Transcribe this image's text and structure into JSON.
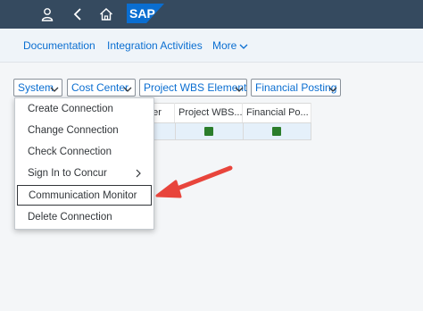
{
  "shell": {
    "buttons": [
      {
        "name": "user-icon"
      },
      {
        "name": "back-icon"
      },
      {
        "name": "home-icon"
      }
    ],
    "logo_text": "SAP",
    "logo_color": "#0a6ed1"
  },
  "menubar": {
    "items": [
      {
        "label": "Documentation"
      },
      {
        "label": "Integration Activities"
      },
      {
        "label": "More"
      }
    ]
  },
  "filters": [
    {
      "label": "System"
    },
    {
      "label": "Cost Center"
    },
    {
      "label": "Project WBS Element"
    },
    {
      "label": "Financial Posting"
    }
  ],
  "table": {
    "headers": [
      "nter",
      "Project WBS...",
      "Financial Po..."
    ],
    "status_color": "#2b7d2b"
  },
  "dropdown": {
    "items": [
      {
        "label": "Create Connection",
        "submenu": false
      },
      {
        "label": "Change Connection",
        "submenu": false
      },
      {
        "label": "Check Connection",
        "submenu": false
      },
      {
        "label": "Sign In to Concur",
        "submenu": true
      },
      {
        "label": "Communication Monitor",
        "submenu": false,
        "selected": true
      },
      {
        "label": "Delete Connection",
        "submenu": false
      }
    ]
  },
  "annotation": {
    "color": "#e8453c"
  }
}
